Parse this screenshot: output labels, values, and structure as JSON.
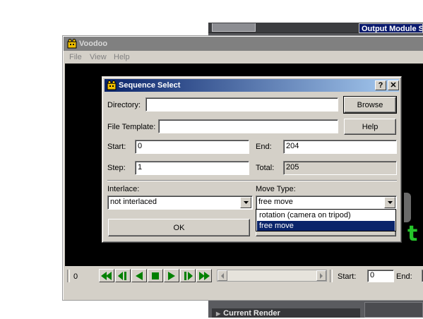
{
  "background_app": {
    "output_module_title": "Output Module S",
    "current_render_label": "Current Render"
  },
  "voodoo": {
    "title": "Voodoo",
    "menu": [
      "File",
      "View",
      "Help"
    ],
    "viewport_text": "t",
    "frame_number": "0",
    "player_controls": [
      "first-frame-icon",
      "step-back-icon",
      "play-backward-icon",
      "stop-icon",
      "play-forward-icon",
      "step-forward-icon",
      "last-frame-icon"
    ],
    "range_start_label": "Start:",
    "range_start_value": "0",
    "range_end_label": "End:",
    "accent_color": "#008000"
  },
  "dialog": {
    "title": "Sequence Select",
    "help_glyph": "?",
    "close_glyph": "✕",
    "directory_label": "Directory:",
    "directory_value": "",
    "browse_label": "Browse",
    "file_template_label": "File Template:",
    "file_template_value": "",
    "help_label": "Help",
    "start_label": "Start:",
    "start_value": "0",
    "end_label": "End:",
    "end_value": "204",
    "step_label": "Step:",
    "step_value": "1",
    "total_label": "Total:",
    "total_value": "205",
    "interlace_label": "Interlace:",
    "interlace_value": "not interlaced",
    "move_type_label": "Move Type:",
    "move_type_value": "free move",
    "move_type_options": [
      "rotation (camera on tripod)",
      "free move"
    ],
    "ok_label": "OK",
    "title_gradient": [
      "#0a246a",
      "#a6caf0"
    ]
  }
}
